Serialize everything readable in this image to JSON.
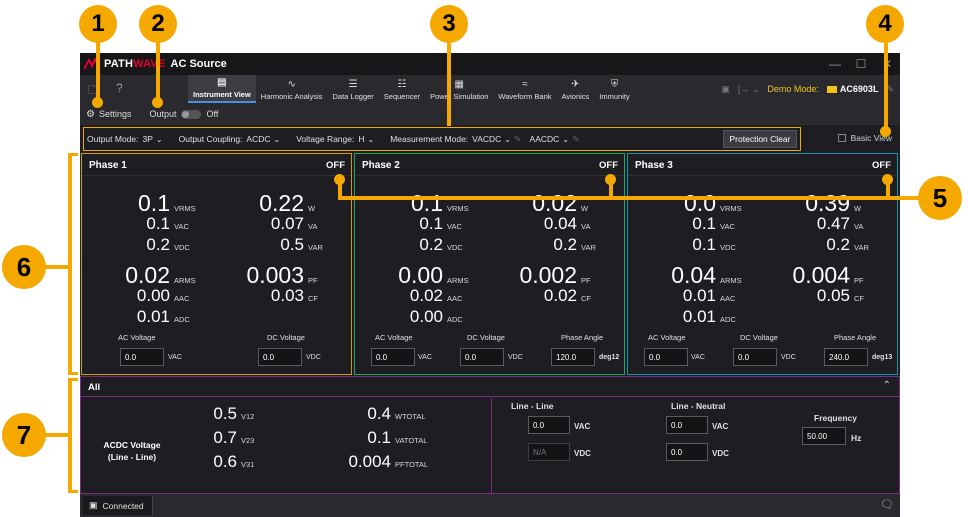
{
  "app": {
    "brand_pre": "PATH",
    "brand_wave": "WAVE",
    "title": "AC Source"
  },
  "toolbar": {
    "tabs": [
      {
        "label": "Instrument View",
        "icon": "instrument-view-icon",
        "active": true
      },
      {
        "label": "Harmonic Analysis",
        "icon": "harmonic-analysis-icon",
        "active": false
      },
      {
        "label": "Data Logger",
        "icon": "data-logger-icon",
        "active": false
      },
      {
        "label": "Sequencer",
        "icon": "sequencer-icon",
        "active": false
      },
      {
        "label": "Power Simulation",
        "icon": "power-simulation-icon",
        "active": false
      },
      {
        "label": "Waveform Bank",
        "icon": "waveform-bank-icon",
        "active": false
      },
      {
        "label": "Avionics",
        "icon": "avionics-icon",
        "active": false
      },
      {
        "label": "Immunity",
        "icon": "immunity-icon",
        "active": false
      }
    ],
    "demo_label": "Demo Mode:",
    "model": "AC6903L"
  },
  "settings_row": {
    "settings_label": "Settings",
    "output_label": "Output",
    "output_state": "Off"
  },
  "config": {
    "output_mode_label": "Output Mode:",
    "output_mode": "3P",
    "coupling_label": "Output Coupling:",
    "coupling": "ACDC",
    "range_label": "Voltage Range:",
    "range": "H",
    "meas_label": "Measurement Mode:",
    "meas_v": "VACDC",
    "meas_a": "AACDC",
    "protection_clear": "Protection Clear",
    "basic_view": "Basic View"
  },
  "phases": [
    {
      "title": "Phase 1",
      "state": "OFF",
      "vrms": "0.1",
      "vac": "0.1",
      "vdc": "0.2",
      "w": "0.22",
      "va": "0.07",
      "var": "0.5",
      "arms": "0.02",
      "aac": "0.00",
      "adc": "0.01",
      "pf": "0.003",
      "cf": "0.03",
      "ac_voltage_label": "AC Voltage",
      "ac_voltage": "0.0",
      "ac_unit": "VAC",
      "dc_voltage_label": "DC Voltage",
      "dc_voltage": "0.0",
      "dc_unit": "VDC"
    },
    {
      "title": "Phase 2",
      "state": "OFF",
      "vrms": "0.1",
      "vac": "0.1",
      "vdc": "0.2",
      "w": "0.02",
      "va": "0.04",
      "var": "0.2",
      "arms": "0.00",
      "aac": "0.02",
      "adc": "0.00",
      "pf": "0.002",
      "cf": "0.02",
      "ac_voltage_label": "AC Voltage",
      "ac_voltage": "0.0",
      "ac_unit": "VAC",
      "dc_voltage_label": "DC Voltage",
      "dc_voltage": "0.0",
      "dc_unit": "VDC",
      "phase_angle_label": "Phase Angle",
      "phase_angle": "120.0",
      "phase_unit": "deg12"
    },
    {
      "title": "Phase 3",
      "state": "OFF",
      "vrms": "0.0",
      "vac": "0.1",
      "vdc": "0.1",
      "w": "0.39",
      "va": "0.47",
      "var": "0.2",
      "arms": "0.04",
      "aac": "0.01",
      "adc": "0.01",
      "pf": "0.004",
      "cf": "0.05",
      "ac_voltage_label": "AC Voltage",
      "ac_voltage": "0.0",
      "ac_unit": "VAC",
      "dc_voltage_label": "DC Voltage",
      "dc_voltage": "0.0",
      "dc_unit": "VDC",
      "phase_angle_label": "Phase Angle",
      "phase_angle": "240.0",
      "phase_unit": "deg13"
    }
  ],
  "units": {
    "vrms": "VRMS",
    "vac": "VAC",
    "vdc": "VDC",
    "w": "W",
    "va": "VA",
    "var": "VAR",
    "arms": "ARMS",
    "aac": "AAC",
    "adc": "ADC",
    "pf": "PF",
    "cf": "CF"
  },
  "all": {
    "title": "All",
    "acdc_label_1": "ACDC Voltage",
    "acdc_label_2": "(Line - Line)",
    "v12": "0.5",
    "v12_unit": "V12",
    "v23": "0.7",
    "v23_unit": "V23",
    "v31": "0.6",
    "v31_unit": "V31",
    "wtotal": "0.4",
    "wtotal_unit": "WTOTAL",
    "vatotal": "0.1",
    "vatotal_unit": "VATOTAL",
    "pftotal": "0.004",
    "pftotal_unit": "PFTOTAL",
    "line_line_label": "Line - Line",
    "line_neutral_label": "Line - Neutral",
    "ll_ac": "0.0",
    "ll_ac_unit": "VAC",
    "ll_dc": "N/A",
    "ll_dc_unit": "VDC",
    "ln_ac": "0.0",
    "ln_ac_unit": "VAC",
    "ln_dc": "0.0",
    "ln_dc_unit": "VDC",
    "frequency_label": "Frequency",
    "frequency": "50.00",
    "frequency_unit": "Hz"
  },
  "status": {
    "connection": "Connected"
  },
  "callouts": [
    "1",
    "2",
    "3",
    "4",
    "5",
    "6",
    "7"
  ],
  "colors": {
    "callout": "#f5a800",
    "phase1_border": "#c8a000",
    "phase2_border": "#22a85a",
    "phase3_border": "#1f8fb0",
    "all_border": "#7a2c86",
    "brand_red": "#e4002b"
  }
}
